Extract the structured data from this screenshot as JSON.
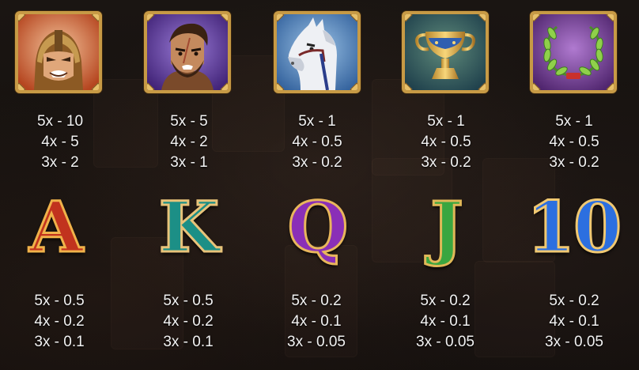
{
  "colors": {
    "gold_frame": "#c79a45",
    "payout_text": "#f2f2f2",
    "letter_a": "#c1331e",
    "letter_k": "#1c8f86",
    "letter_q": "#8a2fb7",
    "letter_j": "#3aa640",
    "letter_10": "#2c6fe0"
  },
  "symbols": [
    {
      "icon": "spartan-helmet-icon",
      "payouts": [
        "5x - 10",
        "4x - 5",
        "3x - 2"
      ]
    },
    {
      "icon": "gladiator-icon",
      "payouts": [
        "5x - 5",
        "4x - 2",
        "3x - 1"
      ]
    },
    {
      "icon": "white-horse-icon",
      "payouts": [
        "5x - 1",
        "4x - 0.5",
        "3x - 0.2"
      ]
    },
    {
      "icon": "golden-cup-icon",
      "payouts": [
        "5x - 1",
        "4x - 0.5",
        "3x - 0.2"
      ]
    },
    {
      "icon": "laurel-wreath-icon",
      "payouts": [
        "5x - 1",
        "4x - 0.5",
        "3x - 0.2"
      ]
    },
    {
      "letter": "A",
      "payouts": [
        "5x - 0.5",
        "4x - 0.2",
        "3x - 0.1"
      ]
    },
    {
      "letter": "K",
      "payouts": [
        "5x - 0.5",
        "4x - 0.2",
        "3x - 0.1"
      ]
    },
    {
      "letter": "Q",
      "payouts": [
        "5x - 0.2",
        "4x - 0.1",
        "3x - 0.05"
      ]
    },
    {
      "letter": "J",
      "payouts": [
        "5x - 0.2",
        "4x - 0.1",
        "3x - 0.05"
      ]
    },
    {
      "letter": "10",
      "payouts": [
        "5x - 0.2",
        "4x - 0.1",
        "3x - 0.05"
      ]
    }
  ]
}
